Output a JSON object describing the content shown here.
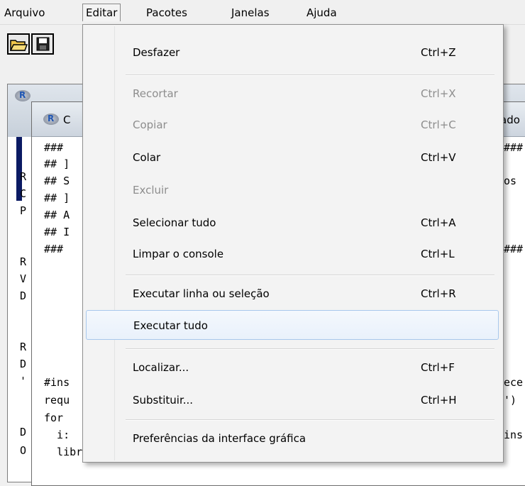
{
  "menubar": {
    "items": [
      "Arquivo",
      "Editar",
      "Pacotes",
      "Janelas",
      "Ajuda"
    ]
  },
  "toolbar": {
    "open_icon": "folder-open-icon",
    "save_icon": "floppy-disk-icon"
  },
  "background": {
    "window1_left_chars": [
      "R",
      "C",
      "P",
      "R",
      "V",
      "D",
      "R",
      "D",
      "'",
      "D",
      "O"
    ],
    "window2_title_left": "C",
    "window2_title_right": "ado",
    "window2_code_left": [
      "###",
      "## ]",
      "## S",
      "## ]",
      "## A",
      "## I",
      "###",
      "#ins",
      "requ",
      "for",
      "  i:",
      "  library(p, character.only = TRUE)"
    ],
    "window2_code_right": [
      "###",
      "",
      "os",
      "",
      "",
      "",
      "###",
      "ece",
      "')",
      "",
      "ins"
    ]
  },
  "menu": {
    "items": [
      {
        "label": "Desfazer",
        "shortcut": "Ctrl+Z",
        "enabled": true
      },
      {
        "label": "Recortar",
        "shortcut": "Ctrl+X",
        "enabled": false
      },
      {
        "label": "Copiar",
        "shortcut": "Ctrl+C",
        "enabled": false
      },
      {
        "label": "Colar",
        "shortcut": "Ctrl+V",
        "enabled": true
      },
      {
        "label": "Excluir",
        "shortcut": "",
        "enabled": false
      },
      {
        "label": "Selecionar tudo",
        "shortcut": "Ctrl+A",
        "enabled": true
      },
      {
        "label": "Limpar o console",
        "shortcut": "Ctrl+L",
        "enabled": true
      },
      {
        "label": "Executar linha ou seleção",
        "shortcut": "Ctrl+R",
        "enabled": true
      },
      {
        "label": "Executar tudo",
        "shortcut": "",
        "enabled": true,
        "highlighted": true
      },
      {
        "label": "Localizar...",
        "shortcut": "Ctrl+F",
        "enabled": true
      },
      {
        "label": "Substituir...",
        "shortcut": "Ctrl+H",
        "enabled": true
      },
      {
        "label": "Preferências da interface gráfica",
        "shortcut": "",
        "enabled": true
      }
    ]
  },
  "colors": {
    "highlight_border": "#a8c8ec",
    "disabled_text": "#8d8d8d"
  }
}
